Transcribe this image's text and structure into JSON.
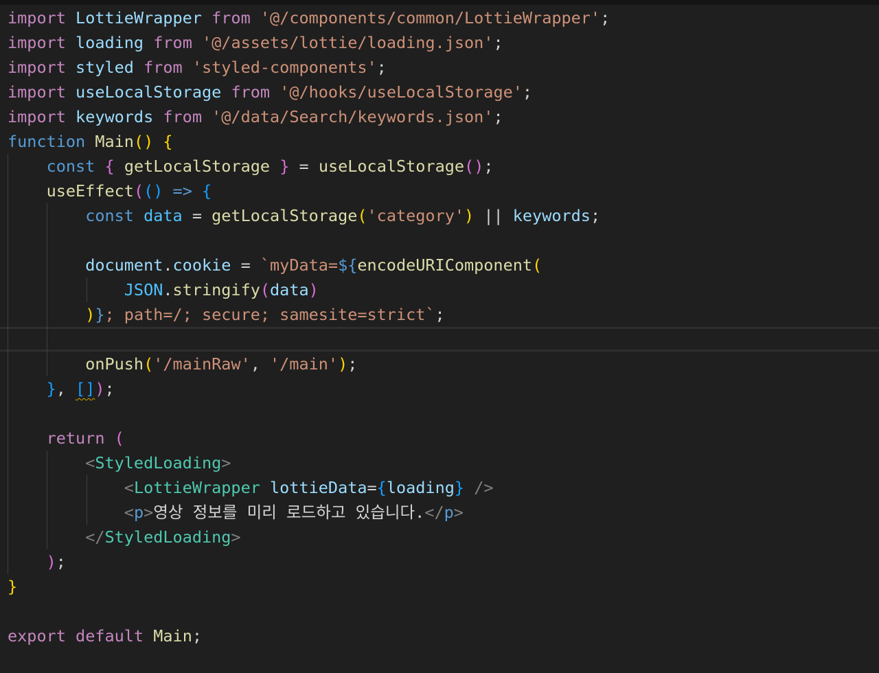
{
  "editor": {
    "lines": [
      [
        [
          "import",
          "kw-ctrl"
        ],
        [
          " ",
          "plain"
        ],
        [
          "LottieWrapper",
          "var"
        ],
        [
          " ",
          "plain"
        ],
        [
          "from",
          "kw-ctrl"
        ],
        [
          " ",
          "plain"
        ],
        [
          "'@/components/common/LottieWrapper'",
          "str"
        ],
        [
          ";",
          "plain"
        ]
      ],
      [
        [
          "import",
          "kw-ctrl"
        ],
        [
          " ",
          "plain"
        ],
        [
          "loading",
          "var"
        ],
        [
          " ",
          "plain"
        ],
        [
          "from",
          "kw-ctrl"
        ],
        [
          " ",
          "plain"
        ],
        [
          "'@/assets/lottie/loading.json'",
          "str"
        ],
        [
          ";",
          "plain"
        ]
      ],
      [
        [
          "import",
          "kw-ctrl"
        ],
        [
          " ",
          "plain"
        ],
        [
          "styled",
          "var"
        ],
        [
          " ",
          "plain"
        ],
        [
          "from",
          "kw-ctrl"
        ],
        [
          " ",
          "plain"
        ],
        [
          "'styled-components'",
          "str"
        ],
        [
          ";",
          "plain"
        ]
      ],
      [
        [
          "import",
          "kw-ctrl"
        ],
        [
          " ",
          "plain"
        ],
        [
          "useLocalStorage",
          "var"
        ],
        [
          " ",
          "plain"
        ],
        [
          "from",
          "kw-ctrl"
        ],
        [
          " ",
          "plain"
        ],
        [
          "'@/hooks/useLocalStorage'",
          "str"
        ],
        [
          ";",
          "plain"
        ]
      ],
      [
        [
          "import",
          "kw-ctrl"
        ],
        [
          " ",
          "plain"
        ],
        [
          "keywords",
          "var"
        ],
        [
          " ",
          "plain"
        ],
        [
          "from",
          "kw-ctrl"
        ],
        [
          " ",
          "plain"
        ],
        [
          "'@/data/Search/keywords.json'",
          "str"
        ],
        [
          ";",
          "plain"
        ]
      ],
      [
        [
          "function",
          "kw-stor"
        ],
        [
          " ",
          "plain"
        ],
        [
          "Main",
          "fn"
        ],
        [
          "()",
          "br-y"
        ],
        [
          " ",
          "plain"
        ],
        [
          "{",
          "br-y"
        ]
      ],
      [
        [
          "    ",
          "plain"
        ],
        [
          "const",
          "kw-stor"
        ],
        [
          " ",
          "plain"
        ],
        [
          "{",
          "br-p"
        ],
        [
          " ",
          "plain"
        ],
        [
          "getLocalStorage",
          "fn"
        ],
        [
          " ",
          "plain"
        ],
        [
          "}",
          "br-p"
        ],
        [
          " = ",
          "plain"
        ],
        [
          "useLocalStorage",
          "fn"
        ],
        [
          "()",
          "br-p"
        ],
        [
          ";",
          "plain"
        ]
      ],
      [
        [
          "    ",
          "plain"
        ],
        [
          "useEffect",
          "fn"
        ],
        [
          "(",
          "br-p"
        ],
        [
          "()",
          "br-b"
        ],
        [
          " ",
          "plain"
        ],
        [
          "=>",
          "kw-stor"
        ],
        [
          " ",
          "plain"
        ],
        [
          "{",
          "br-b"
        ]
      ],
      [
        [
          "        ",
          "plain"
        ],
        [
          "const",
          "kw-stor"
        ],
        [
          " ",
          "plain"
        ],
        [
          "data",
          "const"
        ],
        [
          " = ",
          "plain"
        ],
        [
          "getLocalStorage",
          "fn"
        ],
        [
          "(",
          "br-y"
        ],
        [
          "'category'",
          "str"
        ],
        [
          ")",
          "br-y"
        ],
        [
          " || ",
          "plain"
        ],
        [
          "keywords",
          "var"
        ],
        [
          ";",
          "plain"
        ]
      ],
      [],
      [
        [
          "        ",
          "plain"
        ],
        [
          "document",
          "var"
        ],
        [
          ".",
          "plain"
        ],
        [
          "cookie",
          "var"
        ],
        [
          " = ",
          "plain"
        ],
        [
          "`myData=",
          "str"
        ],
        [
          "${",
          "kw-stor"
        ],
        [
          "encodeURIComponent",
          "fn"
        ],
        [
          "(",
          "br-y"
        ]
      ],
      [
        [
          "            ",
          "plain"
        ],
        [
          "JSON",
          "const"
        ],
        [
          ".",
          "plain"
        ],
        [
          "stringify",
          "fn"
        ],
        [
          "(",
          "br-p"
        ],
        [
          "data",
          "var"
        ],
        [
          ")",
          "br-p"
        ]
      ],
      [
        [
          "        ",
          "plain"
        ],
        [
          ")",
          "br-y"
        ],
        [
          "}",
          "kw-stor"
        ],
        [
          "; path=/; secure; samesite=strict`",
          "str"
        ],
        [
          ";",
          "plain"
        ]
      ],
      [],
      [
        [
          "        ",
          "plain"
        ],
        [
          "onPush",
          "fn"
        ],
        [
          "(",
          "br-y"
        ],
        [
          "'/mainRaw'",
          "str"
        ],
        [
          ", ",
          "plain"
        ],
        [
          "'/main'",
          "str"
        ],
        [
          ")",
          "br-y"
        ],
        [
          ";",
          "plain"
        ]
      ],
      [
        [
          "    ",
          "plain"
        ],
        [
          "}",
          "br-b"
        ],
        [
          ", ",
          "plain"
        ],
        [
          "[]",
          "br-b squiggle"
        ],
        [
          ")",
          "br-p"
        ],
        [
          ";",
          "plain"
        ]
      ],
      [],
      [
        [
          "    ",
          "plain"
        ],
        [
          "return",
          "kw-ctrl"
        ],
        [
          " ",
          "plain"
        ],
        [
          "(",
          "br-p"
        ]
      ],
      [
        [
          "        ",
          "plain"
        ],
        [
          "<",
          "angle"
        ],
        [
          "StyledLoading",
          "tag"
        ],
        [
          ">",
          "angle"
        ]
      ],
      [
        [
          "            ",
          "plain"
        ],
        [
          "<",
          "angle"
        ],
        [
          "LottieWrapper",
          "tag"
        ],
        [
          " ",
          "plain"
        ],
        [
          "lottieData",
          "var"
        ],
        [
          "=",
          "plain"
        ],
        [
          "{",
          "br-b"
        ],
        [
          "loading",
          "var"
        ],
        [
          "}",
          "br-b"
        ],
        [
          " ",
          "plain"
        ],
        [
          "/>",
          "angle"
        ]
      ],
      [
        [
          "            ",
          "plain"
        ],
        [
          "<",
          "angle"
        ],
        [
          "p",
          "tag-html"
        ],
        [
          ">",
          "angle"
        ],
        [
          "영상 정보를 미리 로드하고 있습니다.",
          "plain"
        ],
        [
          "</",
          "angle"
        ],
        [
          "p",
          "tag-html"
        ],
        [
          ">",
          "angle"
        ]
      ],
      [
        [
          "        ",
          "plain"
        ],
        [
          "</",
          "angle"
        ],
        [
          "StyledLoading",
          "tag"
        ],
        [
          ">",
          "angle"
        ]
      ],
      [
        [
          "    ",
          "plain"
        ],
        [
          ")",
          "br-p"
        ],
        [
          ";",
          "plain"
        ]
      ],
      [
        [
          "}",
          "br-y"
        ]
      ],
      [],
      [
        [
          "export",
          "kw-ctrl"
        ],
        [
          " ",
          "plain"
        ],
        [
          "default",
          "kw-ctrl"
        ],
        [
          " ",
          "plain"
        ],
        [
          "Main",
          "fn"
        ],
        [
          ";",
          "plain"
        ]
      ]
    ]
  }
}
